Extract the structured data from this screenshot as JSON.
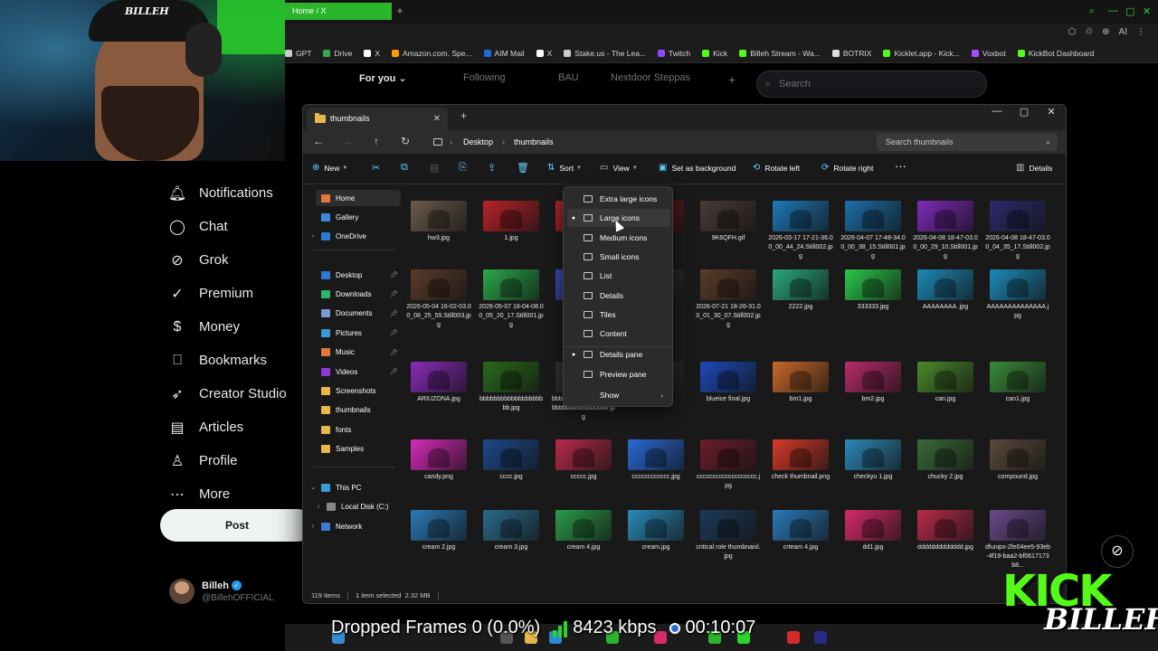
{
  "browser": {
    "tab_title": "Home / X",
    "bookmarks": [
      {
        "label": "GPT",
        "color": "#cccccc"
      },
      {
        "label": "Drive",
        "color": "#34a853"
      },
      {
        "label": "X",
        "color": "#ffffff"
      },
      {
        "label": "Amazon.com. Spe...",
        "color": "#ff9900"
      },
      {
        "label": "AIM Mail",
        "color": "#1d6cd6"
      },
      {
        "label": "X",
        "color": "#ffffff"
      },
      {
        "label": "Stake.us - The Lea...",
        "color": "#cccccc"
      },
      {
        "label": "Twitch",
        "color": "#9146ff"
      },
      {
        "label": "Kick",
        "color": "#53fc18"
      },
      {
        "label": "Billeh Stream - Wa...",
        "color": "#53fc18"
      },
      {
        "label": "BOTRIX",
        "color": "#dddddd"
      },
      {
        "label": "Kicklet.app - Kick...",
        "color": "#53fc18"
      },
      {
        "label": "Voxbot",
        "color": "#a64dff"
      },
      {
        "label": "KickBot Dashboard",
        "color": "#53fc18"
      }
    ]
  },
  "x": {
    "top_tabs": [
      "For you",
      "Following",
      "BAU",
      "Nextdoor Steppas"
    ],
    "search_placeholder": "Search",
    "nav": [
      {
        "label": "Notifications",
        "icon": "bell-icon"
      },
      {
        "label": "Chat",
        "icon": "chat-icon"
      },
      {
        "label": "Grok",
        "icon": "grok-icon"
      },
      {
        "label": "Premium",
        "icon": "premium-icon"
      },
      {
        "label": "Money",
        "icon": "money-icon"
      },
      {
        "label": "Bookmarks",
        "icon": "bookmark-icon"
      },
      {
        "label": "Creator Studio",
        "icon": "rocket-icon"
      },
      {
        "label": "Articles",
        "icon": "article-icon"
      },
      {
        "label": "Profile",
        "icon": "person-icon"
      },
      {
        "label": "More",
        "icon": "more-icon"
      }
    ],
    "post_button": "Post",
    "user_name": "Billeh",
    "user_handle": "@BillehOFFICIAL"
  },
  "explorer": {
    "tab_title": "thumbnails",
    "breadcrumb": [
      "Desktop",
      "thumbnails"
    ],
    "search_placeholder": "Search thumbnails",
    "commands": {
      "new": "New",
      "sort": "Sort",
      "view": "View",
      "set_background": "Set as background",
      "rotate_left": "Rotate left",
      "rotate_right": "Rotate right",
      "details": "Details"
    },
    "sidebar": {
      "home": "Home",
      "gallery": "Gallery",
      "onedrive": "OneDrive",
      "quick": [
        "Desktop",
        "Downloads",
        "Documents",
        "Pictures",
        "Music",
        "Videos",
        "Screenshots",
        "thumbnails",
        "fonts",
        "Samples"
      ],
      "this_pc": "This PC",
      "local_disk": "Local Disk (C:)",
      "network": "Network"
    },
    "files": [
      {
        "name": "hw3.jpg",
        "color": "#6b5a4a"
      },
      {
        "name": "1.jpg",
        "color": "#b8232a"
      },
      {
        "name": "",
        "color": "#b8232a"
      },
      {
        "name": "",
        "color": "#7a1d1d"
      },
      {
        "name": "9K6QFH.gif",
        "color": "#4a3b35"
      },
      {
        "name": "2026-03-17 17-21-36.00_00_44_24.Still002.jpg",
        "color": "#1d79b8"
      },
      {
        "name": "2026-04-07 17-48-34.00_00_38_15.Still001.jpg",
        "color": "#1d6ea8"
      },
      {
        "name": "2026-04-08 18-47-03.00_00_29_10.Still001.jpg",
        "color": "#7d2bb8"
      },
      {
        "name": "2026-04-08 18-47-03.00_04_35_17.Still002.jpg",
        "color": "#2b2b6e"
      },
      {
        "name": "2026-05-04 16-02-03.00_08_25_59.Still003.jpg",
        "color": "#5a3b2a"
      },
      {
        "name": "2026-05-07 18-04-08.00_05_20_17.Still001.jpg",
        "color": "#2ba84a"
      },
      {
        "name": "",
        "color": "#3a4ab8"
      },
      {
        "name": "",
        "color": "#333333"
      },
      {
        "name": "2026-07-21 18-26-31.00_01_30_07.Still002.jpg",
        "color": "#5a3b2a"
      },
      {
        "name": "2222.jpg",
        "color": "#2ba87a"
      },
      {
        "name": "333333.jpg",
        "color": "#2bc84a"
      },
      {
        "name": "AAAAAAAA .jpg",
        "color": "#1d8ab8"
      },
      {
        "name": "AAAAAAAAAAAAAA.jpg",
        "color": "#1d8ab8"
      },
      {
        "name": "ARIUZONA.jpg",
        "color": "#8a2bb8"
      },
      {
        "name": "bbbbbbbbbbbbbbbbbbbb.jpg",
        "color": "#2a6a1d"
      },
      {
        "name": "bbbbbbbbbbbbbbbbbbbbbbbbbbbbbbbbbb.jpg",
        "color": "#333333"
      },
      {
        "name": "",
        "color": "#333333"
      },
      {
        "name": "blueice final.jpg",
        "color": "#1d4ab8"
      },
      {
        "name": "bm1.jpg",
        "color": "#c86a2b"
      },
      {
        "name": "bm2.jpg",
        "color": "#b82b6a"
      },
      {
        "name": "can.jpg",
        "color": "#4a8a2b"
      },
      {
        "name": "can1.jpg",
        "color": "#3a8a3a"
      },
      {
        "name": "candy.png",
        "color": "#d62bb8"
      },
      {
        "name": "cccc.jpg",
        "color": "#1d4a8a"
      },
      {
        "name": "ccccc.jpg",
        "color": "#b82b4a"
      },
      {
        "name": "cccccccccccc.jpg",
        "color": "#2b6ad6"
      },
      {
        "name": "ccccccccccccccccccc.jpg",
        "color": "#6a1d2b"
      },
      {
        "name": "check thumbnail.png",
        "color": "#d63a2b"
      },
      {
        "name": "checkyu 1.jpg",
        "color": "#2b8ab8"
      },
      {
        "name": "chucky 2.jpg",
        "color": "#3a6a3a"
      },
      {
        "name": "compound.jpg",
        "color": "#5a4a3a"
      },
      {
        "name": "cream 2.jpg",
        "color": "#2b7ab8"
      },
      {
        "name": "cream 3.jpg",
        "color": "#2b6a8a"
      },
      {
        "name": "cream 4.jpg",
        "color": "#2b9a4a"
      },
      {
        "name": "cream.jpg",
        "color": "#2b8ab8"
      },
      {
        "name": "critical role thumbnaisl.jpg",
        "color": "#1d3a5a"
      },
      {
        "name": "crteam 4.jpg",
        "color": "#2b7ab8"
      },
      {
        "name": "dd1.jpg",
        "color": "#d62b6a"
      },
      {
        "name": "ddddddddddddd.jpg",
        "color": "#b82b4a"
      },
      {
        "name": "dfunipx-2fe04ee5-93eb-4f19-baa2-bf0617173b8...",
        "color": "#6a4a8a"
      }
    ],
    "status_items": "119 items",
    "status_selected": "1 item selected",
    "status_size": "2.32 MB"
  },
  "view_menu": {
    "items": [
      "Extra large icons",
      "Large icons",
      "Medium icons",
      "Small icons",
      "List",
      "Details",
      "Tiles",
      "Content"
    ],
    "selected": "Large icons",
    "panes": [
      "Details pane",
      "Preview pane"
    ],
    "show": "Show"
  },
  "stream": {
    "dropped_frames": "Dropped Frames 0 (0.0%)",
    "bitrate": "8423 kbps",
    "timer": "00:10:07",
    "logo_top": "KICK",
    "logo_bottom": "BILLEH",
    "cap_text": "BILLEH"
  }
}
